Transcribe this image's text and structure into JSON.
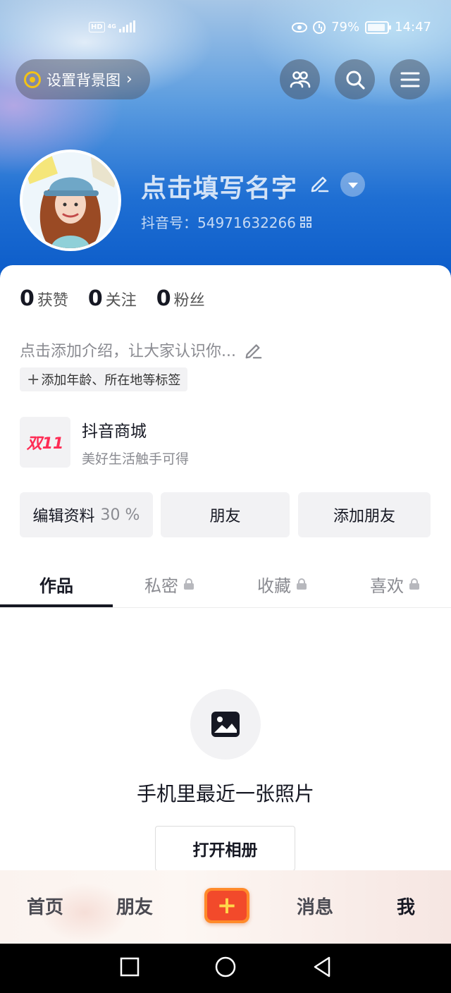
{
  "status_bar": {
    "hd": "HD",
    "network": "4G",
    "battery": "79%",
    "battery_level": 0.79,
    "time": "14:47"
  },
  "header": {
    "background_button": "设置背景图",
    "name": "点击填写名字",
    "douyin_id": "抖音号：54971632266"
  },
  "stats": [
    {
      "num": "0",
      "label": "获赞"
    },
    {
      "num": "0",
      "label": "关注"
    },
    {
      "num": "0",
      "label": "粉丝"
    }
  ],
  "bio": {
    "placeholder": "点击添加介绍，让大家认识你...",
    "tag_button": "添加年龄、所在地等标签"
  },
  "shop": {
    "logo_text": "双11",
    "title": "抖音商城",
    "subtitle": "美好生活触手可得"
  },
  "actions": {
    "edit_profile": "编辑资料",
    "edit_percent": "30 %",
    "friends": "朋友",
    "add_friends": "添加朋友"
  },
  "tabs": [
    {
      "label": "作品"
    },
    {
      "label": "私密"
    },
    {
      "label": "收藏"
    },
    {
      "label": "喜欢"
    }
  ],
  "empty_state": {
    "title": "手机里最近一张照片",
    "button": "打开相册"
  },
  "bottom_nav": {
    "home": "首页",
    "friends": "朋友",
    "plus": "+",
    "messages": "消息",
    "me": "我"
  },
  "colors": {
    "accent": "#fe2c55",
    "plus_orange": "#f24a2b",
    "plus_yellow": "#ffd64a",
    "header_blue": "#1f6fd3",
    "text_primary": "#161823",
    "text_secondary": "#8a8b91"
  },
  "icons": [
    "friends-icon",
    "search-icon",
    "menu-icon",
    "edit-icon",
    "qr-icon",
    "lock-icon",
    "photo-icon",
    "square-icon",
    "circle-icon",
    "back-triangle-icon"
  ]
}
